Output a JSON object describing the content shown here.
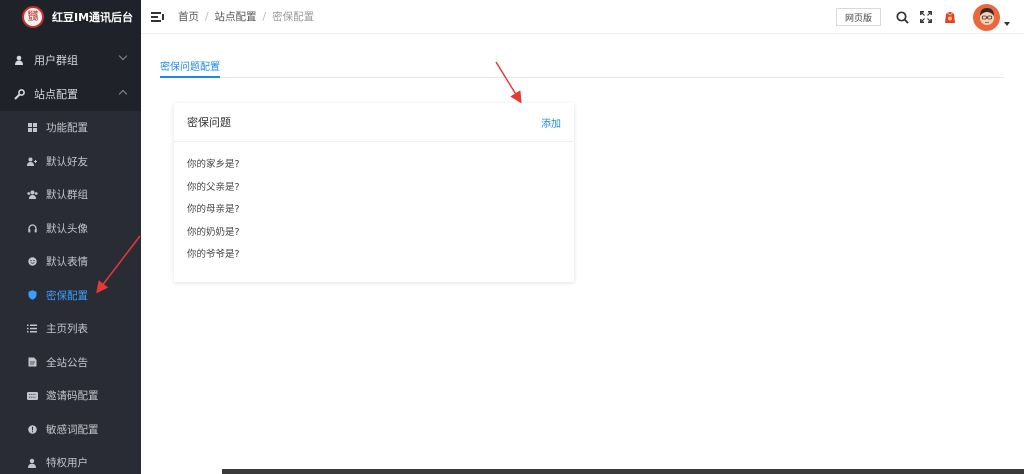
{
  "app": {
    "logo_line1": "科技",
    "logo_line2": "互助",
    "title": "红豆IM通讯后台"
  },
  "sidebar": {
    "groups": [
      {
        "label": "用户群组",
        "expanded": false
      },
      {
        "label": "站点配置",
        "expanded": true
      }
    ],
    "items": [
      {
        "label": "功能配置",
        "icon": "grid-icon"
      },
      {
        "label": "默认好友",
        "icon": "user-add-icon"
      },
      {
        "label": "默认群组",
        "icon": "group-icon"
      },
      {
        "label": "默认头像",
        "icon": "headset-icon"
      },
      {
        "label": "默认表情",
        "icon": "smile-icon"
      },
      {
        "label": "密保配置",
        "icon": "shield-icon",
        "active": true
      },
      {
        "label": "主页列表",
        "icon": "list-icon"
      },
      {
        "label": "全站公告",
        "icon": "notice-icon"
      },
      {
        "label": "邀请码配置",
        "icon": "keyboard-icon"
      },
      {
        "label": "敏感词配置",
        "icon": "alert-icon"
      },
      {
        "label": "特权用户",
        "icon": "vip-icon"
      }
    ]
  },
  "header": {
    "breadcrumb": [
      "首页",
      "站点配置",
      "密保配置"
    ],
    "web_button": "网页版"
  },
  "main": {
    "tab_label": "密保问题配置",
    "card": {
      "title": "密保问题",
      "add_label": "添加",
      "questions": [
        "你的家乡是?",
        "你的父亲是?",
        "你的母亲是?",
        "你的奶奶是?",
        "你的爷爷是?"
      ]
    }
  },
  "colors": {
    "sidebar_bg": "#20222a",
    "submenu_bg": "#2a2c35",
    "accent": "#1e88e5",
    "annotation_arrow": "#e53935"
  }
}
